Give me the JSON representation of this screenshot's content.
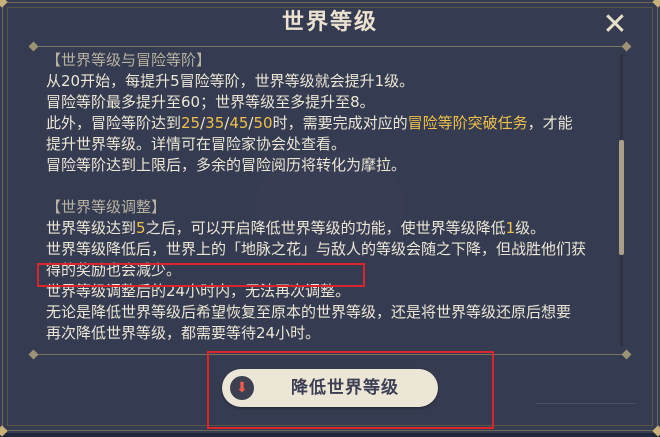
{
  "dialog": {
    "title": "世界等级",
    "close_icon": "close-icon"
  },
  "content": {
    "line1": "【世界等级与冒险等阶】",
    "line2": "从20开始，每提升5冒险等阶，世界等级就会提升1级。",
    "line3": "冒险等阶最多提升至60；世界等级至多提升至8。",
    "line4a": "此外，冒险等阶达到",
    "line4b": "25",
    "line4c": "/",
    "line4d": "35",
    "line4e": "/",
    "line4f": "45",
    "line4g": "/",
    "line4h": "50",
    "line4i": "时，需要完成对应的",
    "line4j": "冒险等阶突破任务",
    "line4k": "，才能",
    "line5": "提升世界等级。详情可在冒险家协会处查看。",
    "line6": "冒险等阶达到上限后，多余的冒险阅历将转化为摩拉。",
    "line7": "【世界等级调整】",
    "line8a": "世界等级达到",
    "line8b": "5",
    "line8c": "之后，可以开启降低世界等级的功能，使世界等级降低",
    "line8d": "1",
    "line8e": "级。",
    "line9": "世界等级降低后，世界上的「地脉之花」与敌人的等级会随之下降，但战胜他们获",
    "line10": "得的奖励也会减少。",
    "line11": "世界等级调整后的24小时内，无法再次调整。",
    "line12": "无论是降低世界等级后希望恢复至原本的世界等级，还是将世界等级还原后想要",
    "line13": "再次降低世界等级，都需要等待24小时。"
  },
  "button": {
    "label": "降低世界等级",
    "icon": "lower-arrow-icon",
    "icon_glyph": "⬇"
  },
  "colors": {
    "background": "#353b50",
    "highlight": "#f0c14a",
    "text": "#ece6d6",
    "annotation": "#d8262c"
  }
}
